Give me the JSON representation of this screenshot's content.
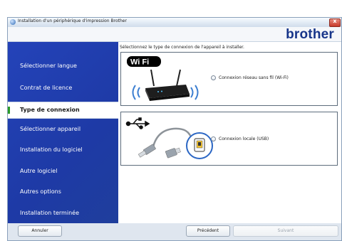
{
  "window": {
    "title": "Installation d'un périphérique d'impression Brother",
    "close_glyph": "x",
    "logo": "brother"
  },
  "sidebar": {
    "items": [
      {
        "label": "Sélectionner langue"
      },
      {
        "label": "Contrat de licence"
      },
      {
        "label": "Type de connexion",
        "active": true
      },
      {
        "label": "Sélectionner appareil"
      },
      {
        "label": "Installation du logiciel"
      },
      {
        "label": "Autre logiciel"
      },
      {
        "label": "Autres options"
      },
      {
        "label": "Installation terminée"
      }
    ]
  },
  "main": {
    "instruction": "Sélectionnez le type de connexion de l'appareil à installer.",
    "options": [
      {
        "wifi_logo": "Wi Fi",
        "label": "Connexion réseau sans fil (Wi-Fi)",
        "selected": false,
        "icon": "wifi-router-icon"
      },
      {
        "label": "Connexion locale (USB)",
        "selected": false,
        "icon": "usb-cable-icon"
      }
    ]
  },
  "buttons": {
    "cancel": "Annuler",
    "previous": "Précédent",
    "next": "Suivant"
  },
  "colors": {
    "sidebar": "#2443b9",
    "brand": "#17358a",
    "active_marker": "#2a9c2a"
  }
}
